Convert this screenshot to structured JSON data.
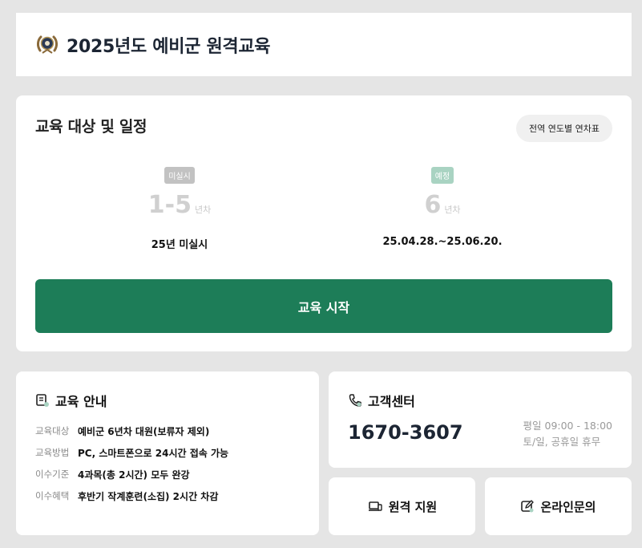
{
  "header": {
    "title": "2025년도 예비군 원격교육",
    "logo_icon": "army-emblem-icon"
  },
  "schedule": {
    "title": "교육 대상 및 일정",
    "table_button": "전역 연도별 연차표",
    "columns": [
      {
        "badge": "미실시",
        "badge_color": "#c2c2c2",
        "number": "1-5",
        "unit": "년차",
        "detail": "25년 미실시"
      },
      {
        "badge": "예정",
        "badge_color": "#a9d3c2",
        "number": "6",
        "unit": "년차",
        "detail": "25.04.28.~25.06.20."
      }
    ],
    "start_button": "교육 시작",
    "accent": "#1d7d58"
  },
  "info": {
    "title": "교육 안내",
    "rows": [
      {
        "key": "교육대상",
        "value": "예비군 6년차 대원(보류자 제외)"
      },
      {
        "key": "교육방법",
        "value": "PC, 스마트폰으로 24시간 접속 가능"
      },
      {
        "key": "이수기준",
        "value": "4과목(총 2시간) 모두 완강"
      },
      {
        "key": "이수혜택",
        "value": "후반기 작계훈련(소집) 2시간 차감"
      }
    ]
  },
  "customer_center": {
    "title": "고객센터",
    "phone": "1670-3607",
    "hours_weekday": "평일 09:00 - 18:00",
    "hours_weekend": "토/일, 공휴일 휴무"
  },
  "buttons": {
    "remote_support": "원격 지원",
    "online_inquiry": "온라인문의"
  }
}
